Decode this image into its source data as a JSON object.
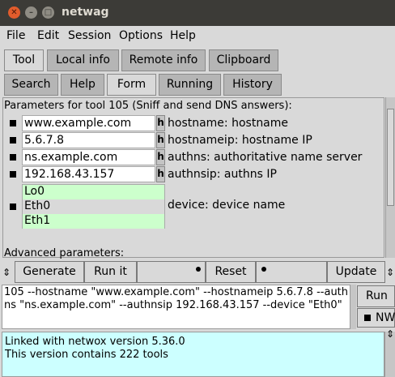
{
  "window": {
    "title": "netwag"
  },
  "menu": [
    "File",
    "Edit",
    "Session",
    "Options",
    "Help"
  ],
  "main_tabs": [
    "Tool",
    "Local info",
    "Remote info",
    "Clipboard"
  ],
  "sub_tabs": [
    "Search",
    "Help",
    "Form",
    "Running",
    "History"
  ],
  "form": {
    "title": "Parameters for tool 105 (Sniff and send DNS answers):",
    "fields": [
      {
        "value": "www.example.com",
        "h": "h",
        "label": "hostname: hostname"
      },
      {
        "value": "5.6.7.8",
        "h": "h",
        "label": "hostnameip: hostname IP"
      },
      {
        "value": "ns.example.com",
        "h": "h",
        "label": "authns: authoritative name server"
      },
      {
        "value": "192.168.43.157",
        "h": "h",
        "label": "authnsip: authns IP"
      }
    ],
    "device": {
      "label": "device: device name",
      "options": [
        "Lo0",
        "Eth0",
        "Eth1"
      ]
    },
    "advanced": "Advanced parameters:"
  },
  "buttons": {
    "generate": "Generate",
    "run_it": "Run it",
    "reset": "Reset",
    "update": "Update"
  },
  "command": "105 --hostname \"www.example.com\" --hostnameip 5.6.7.8 --authns \"ns.example.com\" --authnsip 192.168.43.157 --device \"Eth0\"",
  "side": {
    "run": "Run",
    "nw": "NW"
  },
  "output": [
    "Linked with netwox version 5.36.0",
    "This version contains 222 tools"
  ]
}
